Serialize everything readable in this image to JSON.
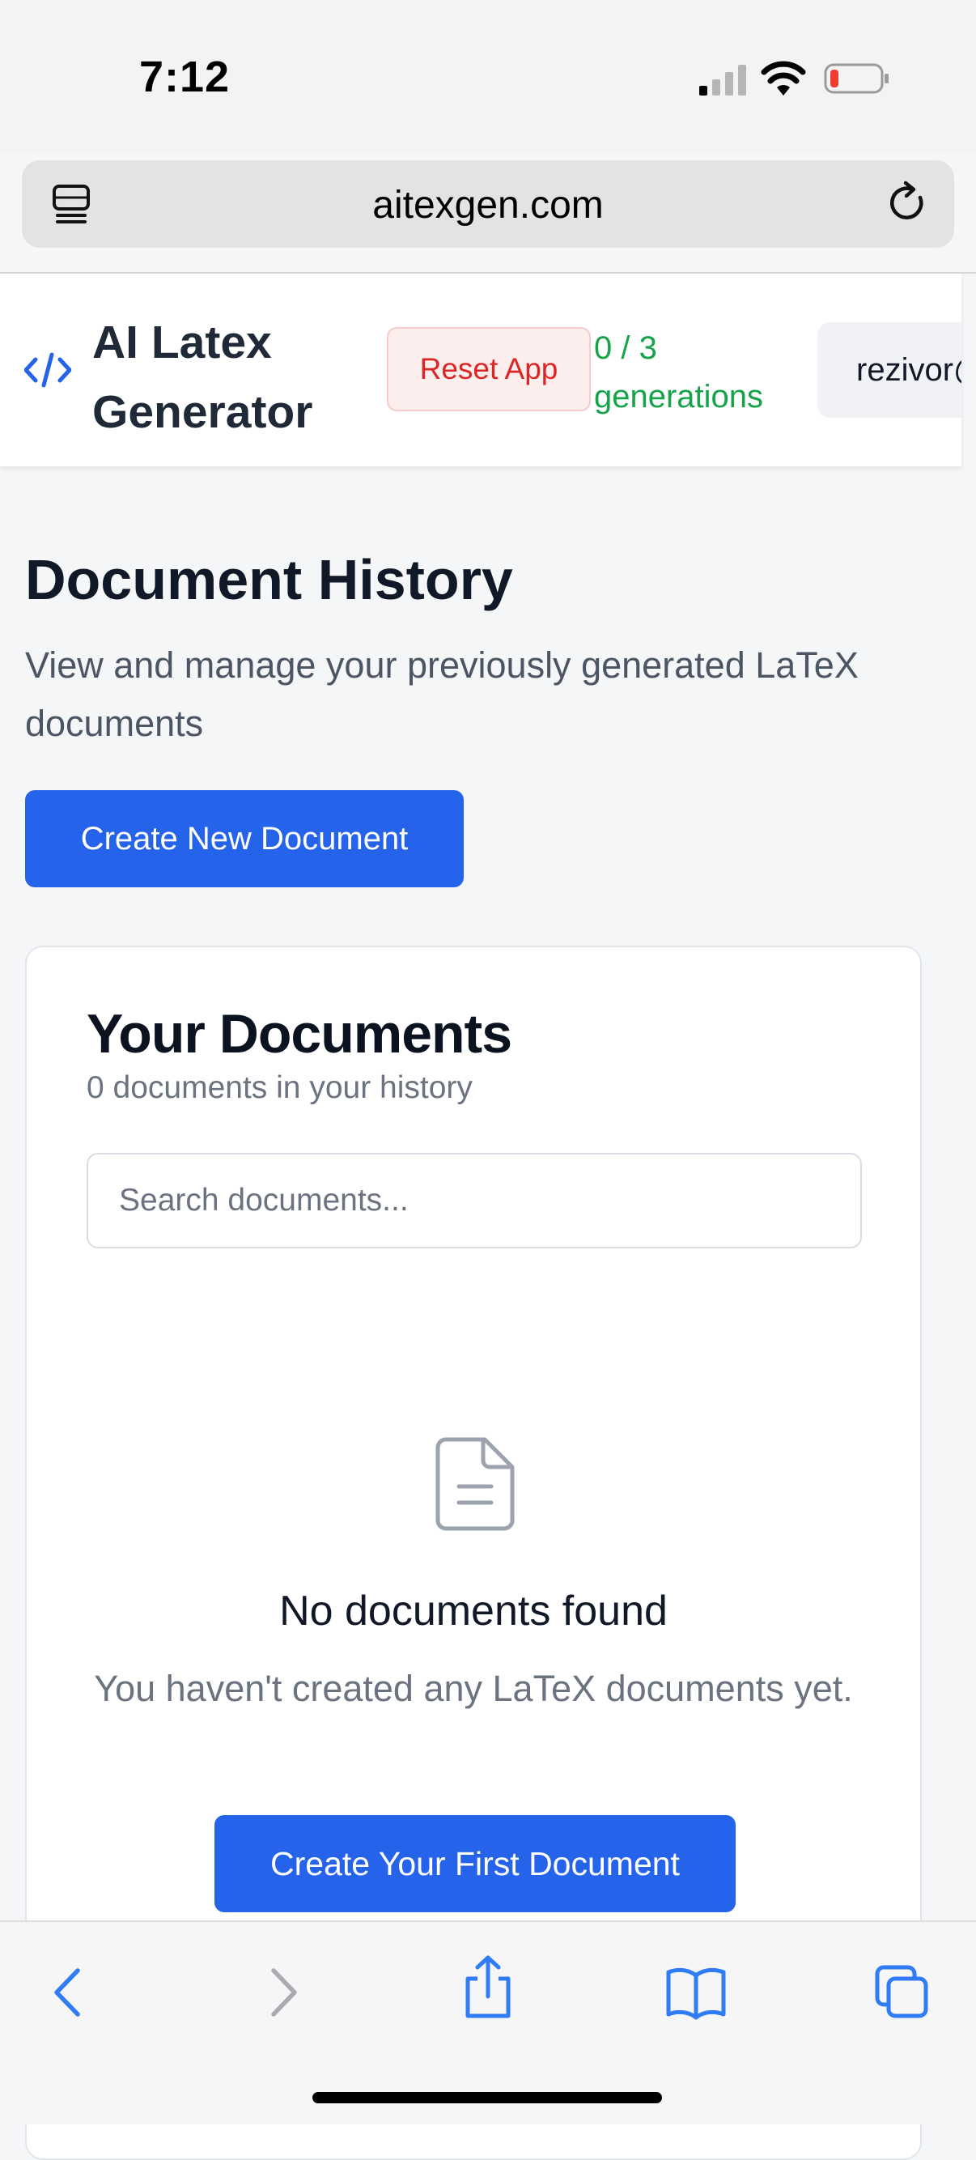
{
  "status_bar": {
    "time": "7:12"
  },
  "browser": {
    "url": "aitexgen.com",
    "icons": {
      "tabs_overview": "tabs-list-icon",
      "reload": "reload-icon",
      "back": "back-icon",
      "forward": "forward-icon",
      "share": "share-icon",
      "bookmarks": "bookmarks-icon",
      "tabs": "tabs-icon"
    }
  },
  "header": {
    "app_title": "AI Latex Generator",
    "reset_label": "Reset App",
    "generations": "0 / 3 generations",
    "user": "rezivor@"
  },
  "main": {
    "title": "Document History",
    "subtitle": "View and manage your previously generated LaTeX documents",
    "create_label": "Create New Document"
  },
  "documents_card": {
    "title": "Your Documents",
    "count_text": "0 documents in your history",
    "search_placeholder": "Search documents...",
    "search_value": "",
    "empty_title": "No documents found",
    "empty_text": "You haven't created any LaTeX documents yet.",
    "first_doc_label": "Create Your First Document"
  },
  "colors": {
    "accent": "#2563eb",
    "danger": "#dc2626",
    "success": "#16a34a"
  }
}
